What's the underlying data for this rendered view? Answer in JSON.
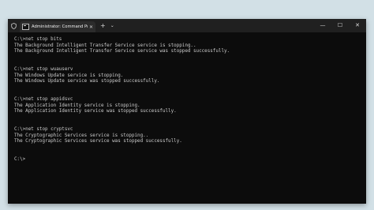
{
  "window": {
    "tab_title": "Administrator: Command Pro",
    "tab_close": "✕",
    "new_tab": "+",
    "tab_dropdown": "⌄",
    "controls": {
      "minimize": "—",
      "maximize": "☐",
      "close": "✕"
    }
  },
  "console": {
    "lines": [
      "C:\\>net stop bits",
      "The Background Intelligent Transfer Service service is stopping..",
      "The Background Intelligent Transfer Service service was stopped successfully.",
      "",
      "",
      "C:\\>net stop wuauserv",
      "The Windows Update service is stopping.",
      "The Windows Update service was stopped successfully.",
      "",
      "",
      "C:\\>net stop appidsvc",
      "The Application Identity service is stopping.",
      "The Application Identity service was stopped successfully.",
      "",
      "",
      "C:\\>net stop cryptsvc",
      "The Cryptographic Services service is stopping..",
      "The Cryptographic Services service was stopped successfully.",
      "",
      "",
      "C:\\>"
    ]
  }
}
